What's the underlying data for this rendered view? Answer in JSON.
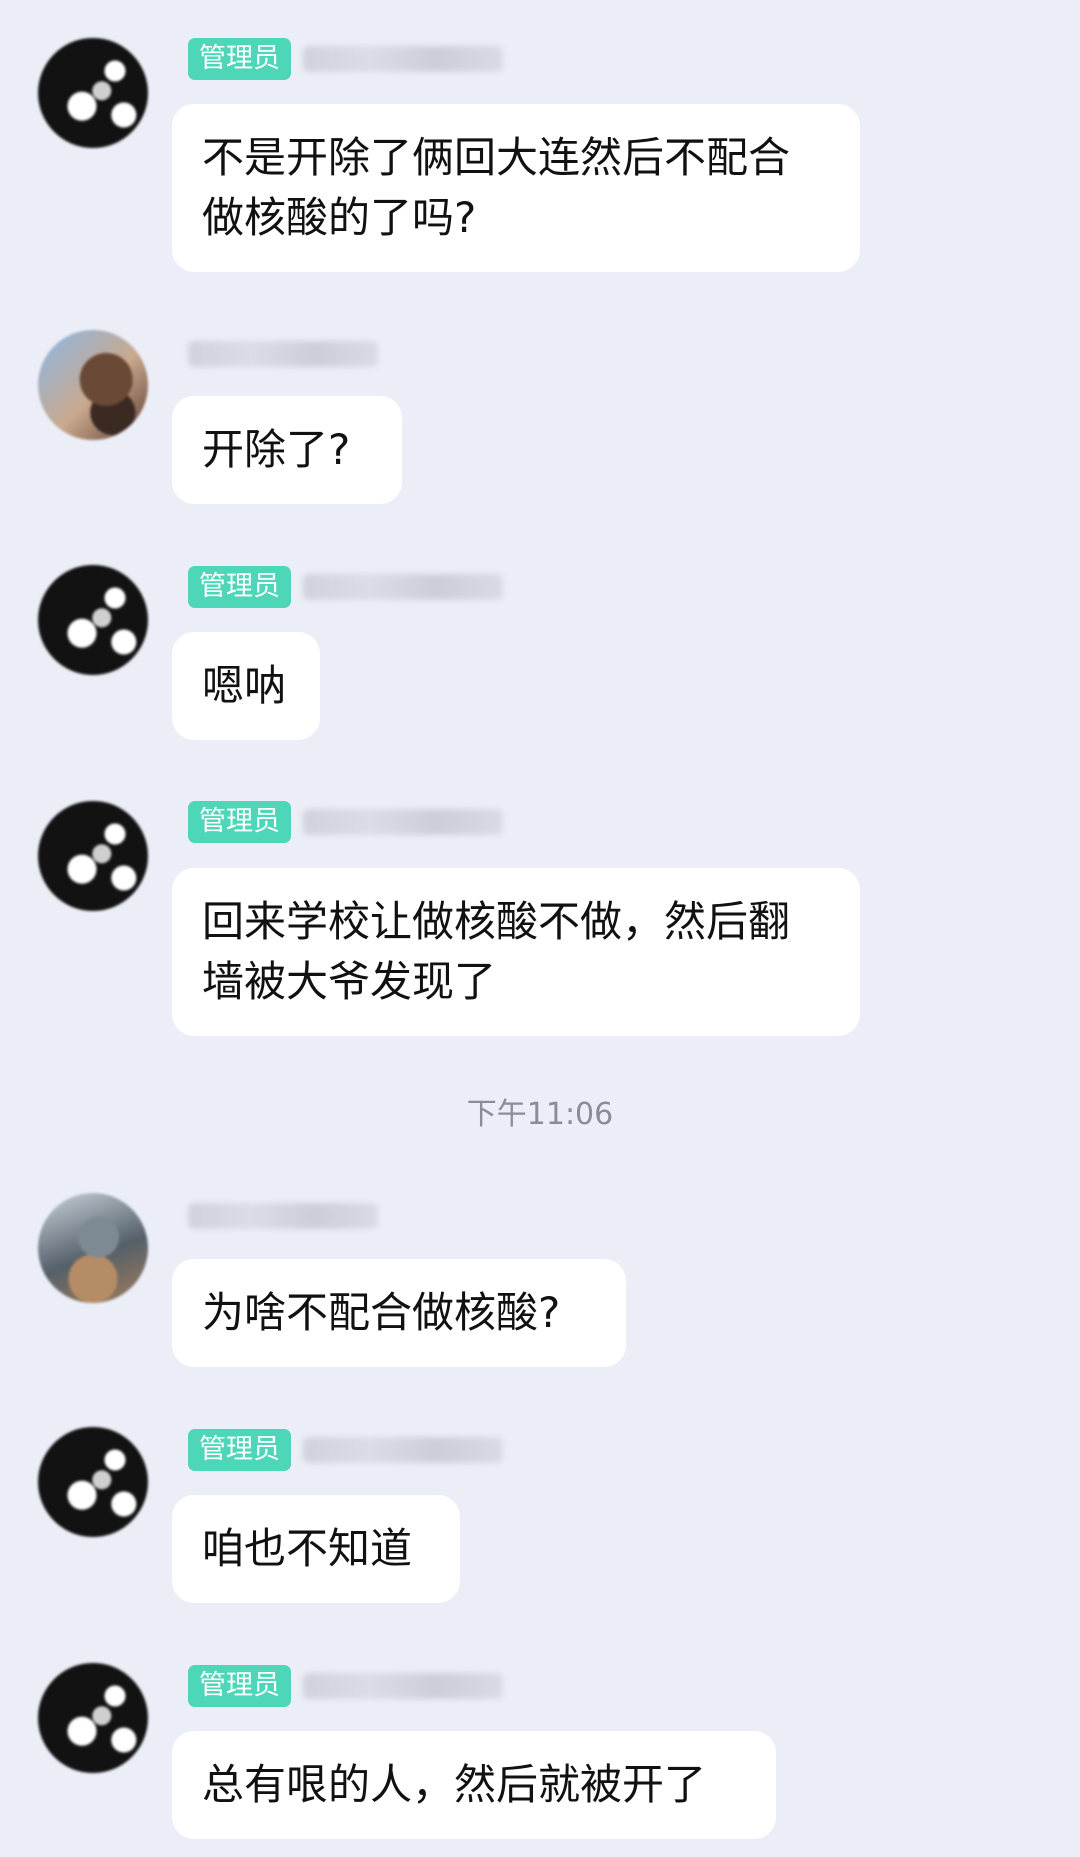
{
  "messages": [
    {
      "avatar": "admin-avatar",
      "role_badge": "管理员",
      "text": "不是开除了俩回大连然后不配合做核酸的了吗?"
    },
    {
      "avatar": "member-avatar-1",
      "role_badge": null,
      "text": "开除了?"
    },
    {
      "avatar": "admin-avatar",
      "role_badge": "管理员",
      "text": "嗯呐"
    },
    {
      "avatar": "admin-avatar",
      "role_badge": "管理员",
      "text": "回来学校让做核酸不做，然后翻墙被大爷发现了"
    },
    {
      "avatar": "member-avatar-2",
      "role_badge": null,
      "text": "为啥不配合做核酸?"
    },
    {
      "avatar": "admin-avatar",
      "role_badge": "管理员",
      "text": "咱也不知道"
    },
    {
      "avatar": "admin-avatar",
      "role_badge": "管理员",
      "text": "总有哏的人，然后就被开了"
    }
  ],
  "timestamp": "下午11:06",
  "colors": {
    "background": "#eceef7",
    "bubble": "#ffffff",
    "admin_badge": "#4dd6b8",
    "timestamp_text": "#8a8c96"
  }
}
